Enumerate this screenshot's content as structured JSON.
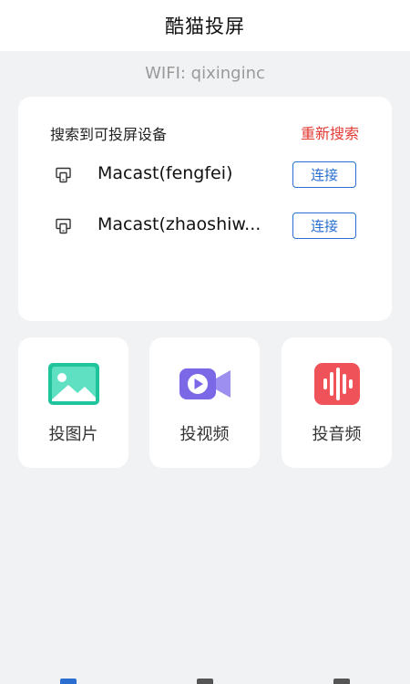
{
  "header": {
    "title": "酷猫投屏"
  },
  "wifi": {
    "label": "WIFI: qixinginc"
  },
  "device_list": {
    "title": "搜索到可投屏设备",
    "rescan_label": "重新搜索",
    "devices": [
      {
        "name": "Macast(fengfei)",
        "connect_label": "连接"
      },
      {
        "name": "Macast(zhaoshiw...",
        "connect_label": "连接"
      }
    ]
  },
  "actions": [
    {
      "label": "投图片",
      "icon": "image-icon",
      "color": "#1fc39c"
    },
    {
      "label": "投视频",
      "icon": "video-icon",
      "color": "#7a68e6"
    },
    {
      "label": "投音频",
      "icon": "audio-icon",
      "color": "#f0525a"
    }
  ],
  "colors": {
    "background": "#f1f2f4",
    "accent_red": "#e23b34",
    "accent_blue": "#2a6fd0"
  }
}
